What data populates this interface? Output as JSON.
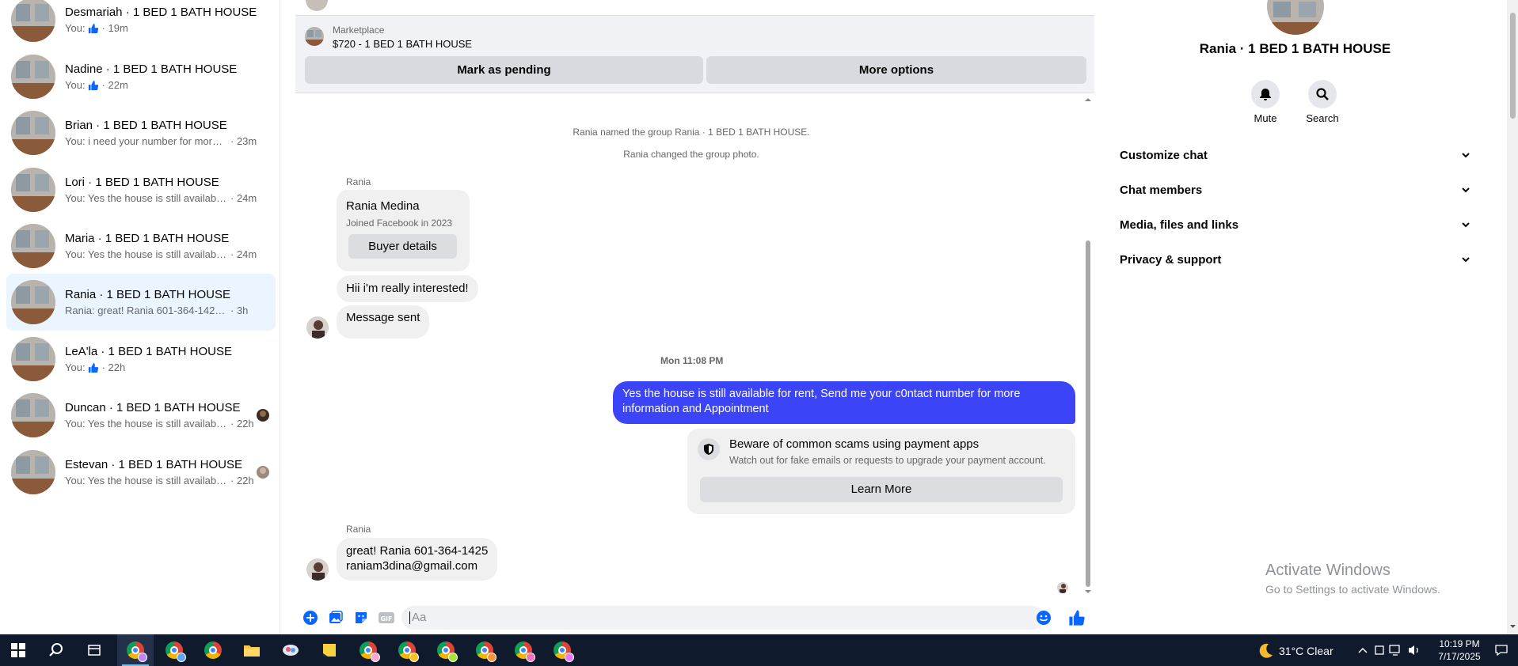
{
  "conversations": [
    {
      "name": "Desmariah · 1 BED 1 BATH HOUSE",
      "preview": "You:",
      "like": true,
      "time": "· 19m"
    },
    {
      "name": "Nadine · 1 BED 1 BATH HOUSE",
      "preview": "You:",
      "like": true,
      "time": "· 22m"
    },
    {
      "name": "Brian · 1 BED 1 BATH HOUSE",
      "preview": "You: i need your number for more in...",
      "like": false,
      "time": "· 23m"
    },
    {
      "name": "Lori · 1 BED 1 BATH HOUSE",
      "preview": "You: Yes the house is still available f...",
      "like": false,
      "time": "· 24m"
    },
    {
      "name": "Maria · 1 BED 1 BATH HOUSE",
      "preview": "You: Yes the house is still available f...",
      "like": false,
      "time": "· 24m"
    },
    {
      "name": "Rania · 1 BED 1 BATH HOUSE",
      "preview": "Rania: great! Rania 601-364-1425 rani...",
      "like": false,
      "time": "· 3h"
    },
    {
      "name": "LeA'la · 1 BED 1 BATH HOUSE",
      "preview": "You:",
      "like": true,
      "time": "· 22h"
    },
    {
      "name": "Duncan · 1 BED 1 BATH HOUSE",
      "preview": "You: Yes the house is still available...",
      "like": false,
      "time": "· 22h"
    },
    {
      "name": "Estevan · 1 BED 1 BATH HOUSE",
      "preview": "You: Yes the house is still available...",
      "like": false,
      "time": "· 22h"
    }
  ],
  "marketplace": {
    "label": "Marketplace",
    "listing": "$720 - 1 BED 1 BATH HOUSE",
    "pending_button": "Mark as pending",
    "more_button": "More options"
  },
  "messages": {
    "sys1": "Rania named the group Rania · 1 BED 1 BATH HOUSE.",
    "sys2": "Rania changed the group photo.",
    "sender1": "Rania",
    "card_name": "Rania Medina",
    "card_sub": "Joined Facebook in 2023",
    "card_button": "Buyer details",
    "msg1": "Hii i'm really interested!",
    "msg2": "Message sent",
    "timestamp": "Mon 11:08 PM",
    "outgoing": "Yes the house is still available for rent, Send me your c0ntact number for more information and Appointment",
    "warn_title": "Beware of common scams using payment apps",
    "warn_sub": "Watch out for fake emails or requests to upgrade your payment account.",
    "warn_button": "Learn More",
    "sender2": "Rania",
    "reply_line1": "great! Rania 601-364-1425",
    "reply_line2": "raniam3dina@gmail.com"
  },
  "composer": {
    "placeholder": "Aa"
  },
  "info_panel": {
    "title": "Rania · 1 BED 1 BATH HOUSE",
    "mute_label": "Mute",
    "search_label": "Search",
    "sections": [
      "Customize chat",
      "Chat members",
      "Media, files and links",
      "Privacy & support"
    ],
    "activate_title": "Activate Windows",
    "activate_sub": "Go to Settings to activate Windows."
  },
  "taskbar": {
    "weather": "31°C  Clear",
    "time": "10:19 PM",
    "date": "7/17/2025"
  },
  "colors": {
    "outgoing_bubble": "#3b44f6",
    "active_conversation": "#ebf5ff",
    "messenger_blue": "#0866ff"
  }
}
